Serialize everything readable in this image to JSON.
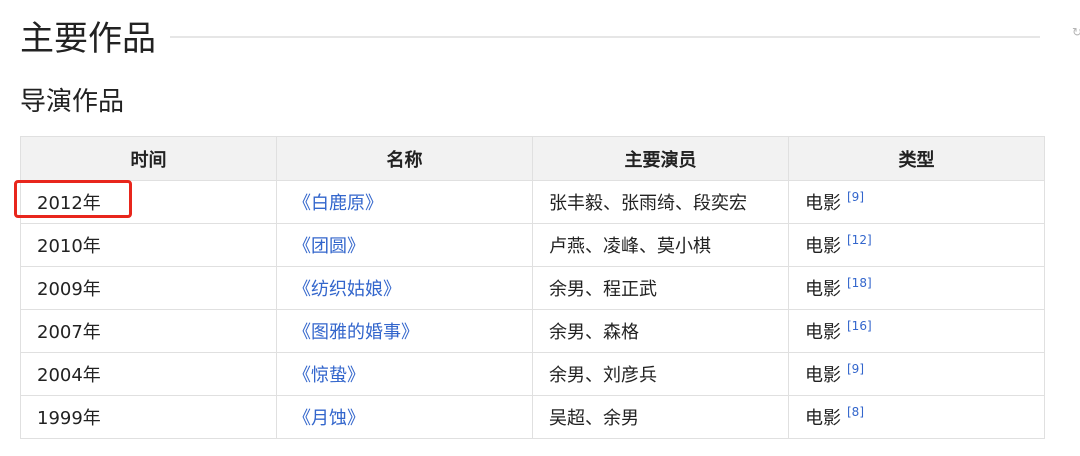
{
  "section": {
    "title": "主要作品"
  },
  "subsection": {
    "title": "导演作品"
  },
  "table": {
    "headers": {
      "time": "时间",
      "name": "名称",
      "cast": "主要演员",
      "type": "类型"
    },
    "rows": [
      {
        "time": "2012年",
        "name": "《白鹿原》",
        "cast": "张丰毅、张雨绮、段奕宏",
        "type": "电影",
        "ref": "[9]"
      },
      {
        "time": "2010年",
        "name": "《团圆》",
        "cast": "卢燕、凌峰、莫小棋",
        "type": "电影",
        "ref": "[12]"
      },
      {
        "time": "2009年",
        "name": "《纺织姑娘》",
        "cast": "余男、程正武",
        "type": "电影",
        "ref": "[18]"
      },
      {
        "time": "2007年",
        "name": "《图雅的婚事》",
        "cast": "余男、森格",
        "type": "电影",
        "ref": "[16]"
      },
      {
        "time": "2004年",
        "name": "《惊蛰》",
        "cast": "余男、刘彦兵",
        "type": "电影",
        "ref": "[9]"
      },
      {
        "time": "1999年",
        "name": "《月蚀》",
        "cast": "吴超、余男",
        "type": "电影",
        "ref": "[8]"
      }
    ]
  },
  "colors": {
    "link": "#3366cc",
    "highlight": "#e8261c",
    "header_bg": "#f2f2f2"
  }
}
